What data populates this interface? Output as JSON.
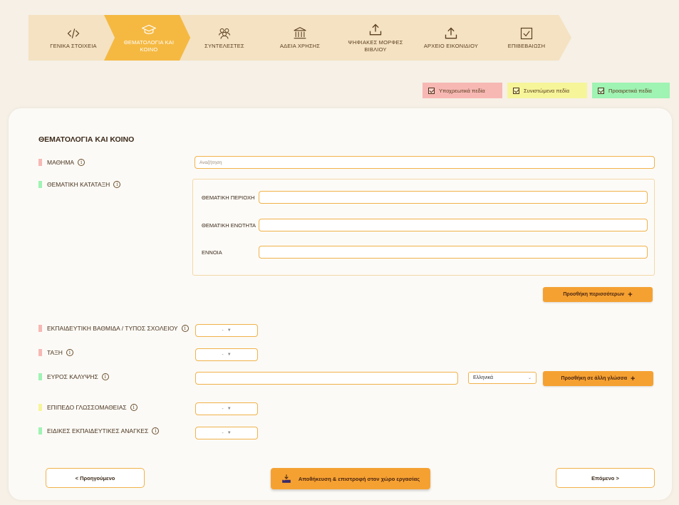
{
  "stepper": {
    "steps": [
      {
        "label": "ΓΕΝΙΚΑ ΣΤΟΙΧΕΙΑ",
        "icon": "code-icon",
        "active": false
      },
      {
        "label": "ΘΕΜΑΤΟΛΟΓΙΑ ΚΑΙ ΚΟΙΝΟ",
        "icon": "graduation-cap-icon",
        "active": true
      },
      {
        "label": "ΣΥΝΤΕΛΕΣΤΕΣ",
        "icon": "users-icon",
        "active": false
      },
      {
        "label": "ΑΔΕΙΑ ΧΡΗΣΗΣ",
        "icon": "institution-icon",
        "active": false
      },
      {
        "label": "ΨΗΦΙΑΚΕΣ ΜΟΡΦΕΣ ΒΙΒΛΙΟΥ",
        "icon": "upload-icon",
        "active": false
      },
      {
        "label": "ΑΡΧΕΙΟ ΕΙΚΟΝΙΔΙΟΥ",
        "icon": "upload-icon",
        "active": false
      },
      {
        "label": "ΕΠΙΒΕΒΑΙΩΣΗ",
        "icon": "checkbox-icon",
        "active": false
      }
    ]
  },
  "legend": {
    "required": "Υποχρεωτικά πεδία",
    "recommended": "Συνιστώμενα πεδία",
    "optional": "Προαιρετικά πεδία"
  },
  "colors": {
    "required": "#f7b8b4",
    "recommended": "#f6f59a",
    "optional": "#9ff3b3",
    "accent": "#f5a132",
    "active_step": "#f5b942"
  },
  "form": {
    "section_title": "ΘΕΜΑΤΟΛΟΓΙΑ ΚΑΙ ΚΟΙΝΟ",
    "subject": {
      "label": "ΜΑΘΗΜΑ",
      "placeholder": "Αναζήτηση"
    },
    "classification": {
      "label": "ΘΕΜΑΤΙΚΗ ΚΑΤΑΤΑΞΗ",
      "area_label": "ΘΕΜΑΤΙΚΗ ΠΕΡΙΟΧΗ",
      "unit_label": "ΘΕΜΑΤΙΚΗ ΕΝΟΤΗΤΑ",
      "concept_label": "ΕΝΝΟΙΑ",
      "add_more": "Προσθήκη περισσότερων"
    },
    "education_level": {
      "label": "ΕΚΠΑΙΔΕΥΤΙΚΗ ΒΑΘΜΙΔΑ / ΤΥΠΟΣ ΣΧΟΛΕΙΟΥ",
      "value": "-"
    },
    "grade": {
      "label": "ΤΑΞΗ",
      "value": "-"
    },
    "coverage": {
      "label": "ΕΥΡΟΣ ΚΑΛΥΨΗΣ",
      "language": "Ελληνικά",
      "add_language": "Προσθήκη σε άλλη γλώσσα"
    },
    "language_level": {
      "label": "ΕΠΙΠΕΔΟ ΓΛΩΣΣΟΜΑΘΕΙΑΣ",
      "value": "-"
    },
    "special_needs": {
      "label": "ΕΙΔΙΚΕΣ ΕΚΠΑΙΔΕΥΤΙΚΕΣ ΑΝΑΓΚΕΣ",
      "value": "-"
    }
  },
  "footer": {
    "previous": "< Προηγούμενο",
    "save": "Αποθήκευση & επιστροφή στον χώρο εργασίας",
    "next": "Επόμενο >"
  }
}
